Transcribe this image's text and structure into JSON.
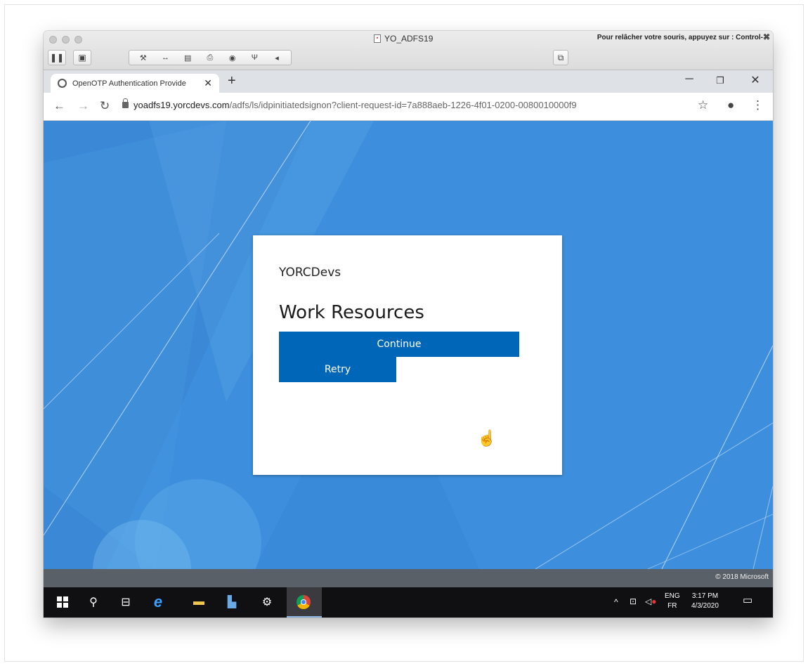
{
  "mac": {
    "window_title": "YO_ADFS19",
    "release_hint": "Pour relâcher votre souris, appuyez sur : Control-⌘"
  },
  "browser": {
    "tab_title": "OpenOTP Authentication Provide",
    "url_host": "yoadfs19.yorcdevs.com",
    "url_path": "/adfs/ls/idpinitiatedsignon?client-request-id=7a888aeb-1226-4f01-0200-0080010000f9"
  },
  "page": {
    "org_name": "YORCDevs",
    "heading": "Work Resources",
    "continue_label": "Continue",
    "retry_label": "Retry",
    "copyright": "© 2018 Microsoft"
  },
  "taskbar": {
    "lang_top": "ENG",
    "lang_bottom": "FR",
    "time": "3:17 PM",
    "date": "4/3/2020"
  },
  "colors": {
    "page_bg": "#3d8fdd",
    "button": "#0067b8"
  }
}
